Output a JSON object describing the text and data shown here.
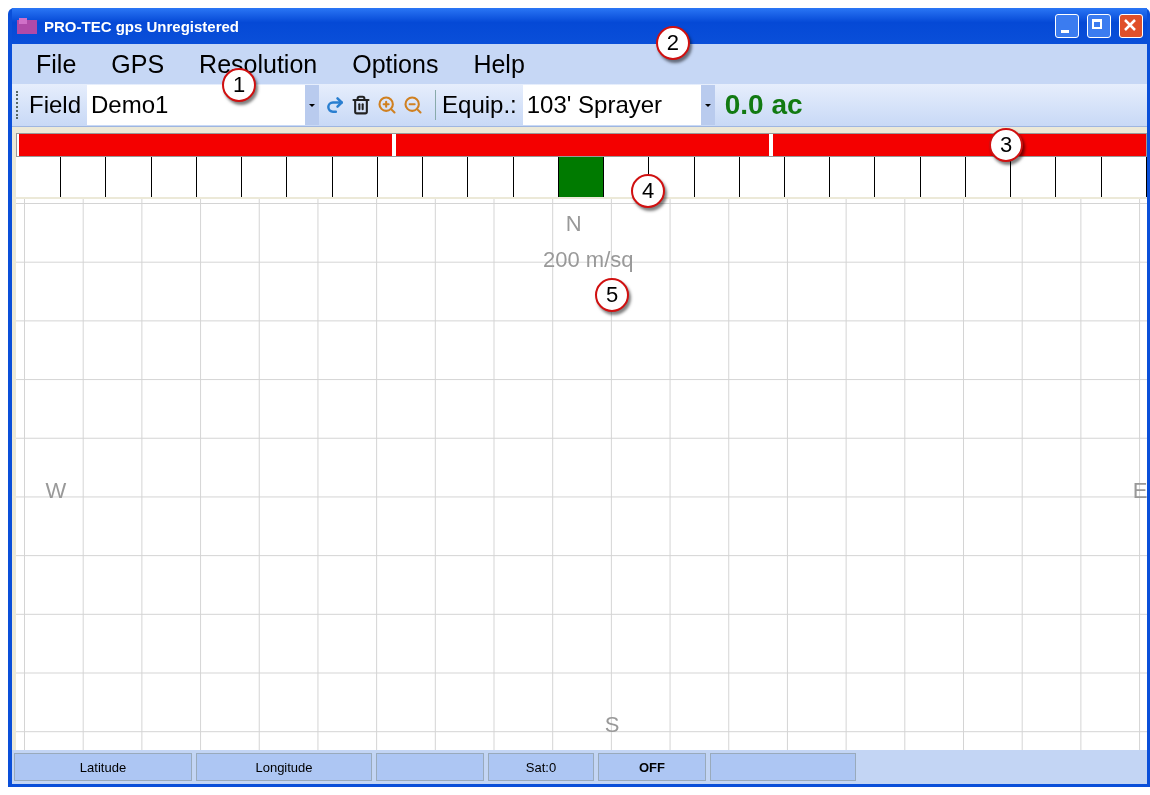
{
  "window": {
    "title": "PRO-TEC gps Unregistered"
  },
  "menu": [
    {
      "label": "File"
    },
    {
      "label": "GPS"
    },
    {
      "label": "Resolution"
    },
    {
      "label": "Options"
    },
    {
      "label": "Help"
    }
  ],
  "toolbar": {
    "field_label": "Field",
    "field_value": "Demo1",
    "field_callout": "1",
    "equip_label": "Equip.:",
    "equip_value": "103' Sprayer",
    "equip_callout": "2",
    "area": "0.0 ac"
  },
  "sections": {
    "callout": "3",
    "items": [
      {
        "on": true
      },
      {
        "on": true
      },
      {
        "on": true
      }
    ]
  },
  "nozzles": {
    "callout": "4",
    "items": [
      {
        "on": false
      },
      {
        "on": false
      },
      {
        "on": false
      },
      {
        "on": false
      },
      {
        "on": false
      },
      {
        "on": false
      },
      {
        "on": false
      },
      {
        "on": false
      },
      {
        "on": false
      },
      {
        "on": false
      },
      {
        "on": false
      },
      {
        "on": false
      },
      {
        "on": true
      },
      {
        "on": false
      },
      {
        "on": false
      },
      {
        "on": false
      },
      {
        "on": false
      },
      {
        "on": false
      },
      {
        "on": false
      },
      {
        "on": false
      },
      {
        "on": false
      },
      {
        "on": false
      },
      {
        "on": false
      },
      {
        "on": false
      },
      {
        "on": false
      }
    ]
  },
  "map": {
    "north": "N",
    "scale": "200 m/sq",
    "west": "W",
    "east": "E",
    "south": "S",
    "callout": "5"
  },
  "status_bar": [
    {
      "kind": "text",
      "text": "Latitude"
    },
    {
      "kind": "text",
      "text": "Longitude"
    },
    {
      "kind": "blank"
    },
    {
      "kind": "text",
      "text": "Sat:0"
    },
    {
      "kind": "bold",
      "text": "OFF"
    },
    {
      "kind": "blank"
    }
  ]
}
